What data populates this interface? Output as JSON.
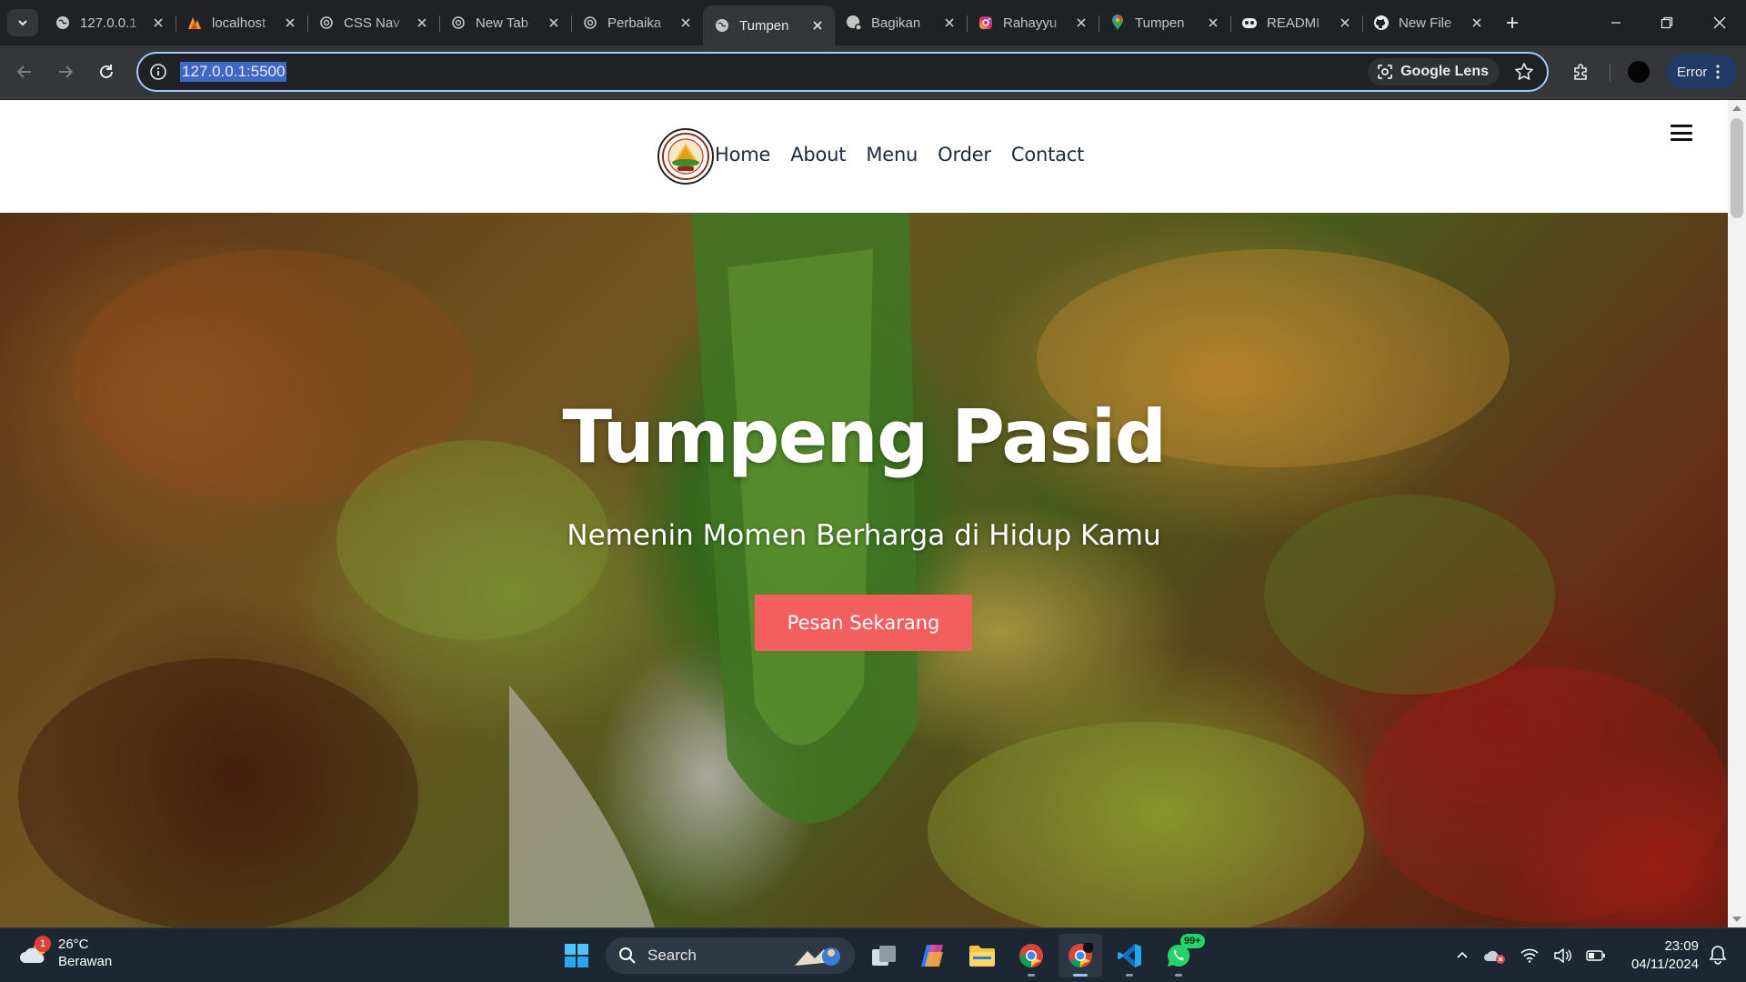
{
  "browser": {
    "tabs": [
      {
        "title": "127.0.0.1",
        "icon": "globe-icon"
      },
      {
        "title": "localhost",
        "icon": "xampp-icon"
      },
      {
        "title": "CSS Nav",
        "icon": "chatgpt-icon"
      },
      {
        "title": "New Tab",
        "icon": "chatgpt-icon"
      },
      {
        "title": "Perbaika",
        "icon": "chatgpt-icon"
      },
      {
        "title": "Tumpen",
        "icon": "globe-icon"
      },
      {
        "title": "Bagikan",
        "icon": "globe-share-icon"
      },
      {
        "title": "Rahayyu",
        "icon": "instagram-icon"
      },
      {
        "title": "Tumpen",
        "icon": "maps-pin-icon"
      },
      {
        "title": "READMI",
        "icon": "copilot-icon"
      },
      {
        "title": "New File",
        "icon": "github-icon"
      }
    ],
    "active_tab_index": 5,
    "url": "127.0.0.1:5500",
    "lens_label": "Google Lens",
    "error_label": "Error"
  },
  "site": {
    "nav": [
      "Home",
      "About",
      "Menu",
      "Order",
      "Contact"
    ],
    "hero": {
      "title": "Tumpeng Pasid",
      "subtitle": "Nemenin Momen Berharga di Hidup Kamu",
      "cta": "Pesan Sekarang"
    },
    "accent_color": "#f35f5c"
  },
  "taskbar": {
    "weather": {
      "temp": "26°C",
      "condition": "Berawan",
      "badge": "1"
    },
    "search_label": "Search",
    "whatsapp_badge": "99+",
    "time": "23:09",
    "date": "04/11/2024"
  }
}
